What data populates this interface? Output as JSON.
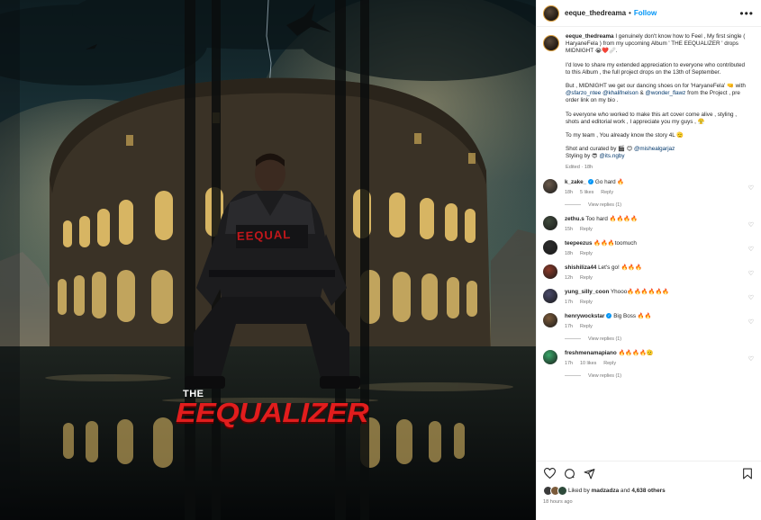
{
  "post": {
    "username": "eeque_thedreama",
    "follow_label": "Follow",
    "separator": "•",
    "more": "•••"
  },
  "artwork": {
    "title_small": "THE",
    "title_big": "EEQUALIZER",
    "jacket_text": "EEQUAL"
  },
  "caption": {
    "username": "eeque_thedreama",
    "p1": "I genuinely don't know how to Feel , My first single ( HaryaneFela ) from my upcoming Album ' THE EEQUALIZER ' drops MIDNIGHT 😭❤️🩹.",
    "p2": "I'd love to share my extended appreciation to everyone who contributed to this Album , the full project drops on the 13th of September.",
    "p3a": "But , MIDNIGHT we get our dancing shoes on for 'HaryaneFela' 🤜 with ",
    "m1": "@sfarzo_ntee",
    "m2": "@khalifnelson",
    "p3b": " & ",
    "m3": "@wonder_flawz",
    "p3c": " from the Project , pre order link on my bio .",
    "p4": "To everyone who worked to make this art cover come alive , styling , shots and editorial work , I appreciate you my guys , 😤",
    "p5": "To my team , You already know the story 4L 🫡",
    "shot": "Shot and curated by 🎬 😊 ",
    "m4": "@mishealgarjaz",
    "styling": "Styling by 😎 ",
    "m5": "@its.ngby",
    "edited": "Edited · 18h"
  },
  "comments": [
    {
      "user": "k_zake_",
      "verified": true,
      "text": "Go hard 🔥",
      "time": "18h",
      "likes": "5 likes",
      "reply": "Reply",
      "view": "View replies (1)",
      "color": "#6b5b4c"
    },
    {
      "user": "zethu.s",
      "verified": false,
      "text": "Too hard 🔥🔥🔥🔥",
      "time": "15h",
      "likes": "",
      "reply": "Reply",
      "view": "",
      "color": "#3f4a3c"
    },
    {
      "user": "teepeezus",
      "verified": false,
      "text": "🔥🔥🔥toomuch",
      "time": "18h",
      "likes": "",
      "reply": "Reply",
      "view": "",
      "color": "#2d2d2d"
    },
    {
      "user": "shishiliza44",
      "verified": false,
      "text": "Let's go! 🔥🔥🔥",
      "time": "12h",
      "likes": "",
      "reply": "Reply",
      "view": "",
      "color": "#8a3a2a"
    },
    {
      "user": "yung_silly_coon",
      "verified": false,
      "text": "Yhooo🔥🔥🔥🔥🔥🔥",
      "time": "17h",
      "likes": "",
      "reply": "Reply",
      "view": "",
      "color": "#4a4a6a"
    },
    {
      "user": "henrywockstar",
      "verified": true,
      "text": "Big Boss 🔥🔥",
      "time": "17h",
      "likes": "",
      "reply": "Reply",
      "view": "View replies (1)",
      "color": "#7a5a3a"
    },
    {
      "user": "freshmenamapiano",
      "verified": false,
      "text": "🔥🔥🔥🔥🫡",
      "time": "17h",
      "likes": "10 likes",
      "reply": "Reply",
      "view": "View replies (1)",
      "color": "#3aa86a"
    }
  ],
  "footer": {
    "liked_prefix": "Liked by ",
    "liked_user": "madzadza",
    "liked_mid": " and ",
    "liked_count": "4,638 others",
    "time": "18 hours ago"
  },
  "icons": [
    "more-icon",
    "heart-icon",
    "comment-icon",
    "share-icon",
    "save-icon"
  ],
  "colors": {
    "accent": "#0095f6",
    "title_red": "#e11d1d",
    "mention": "#00376b"
  }
}
